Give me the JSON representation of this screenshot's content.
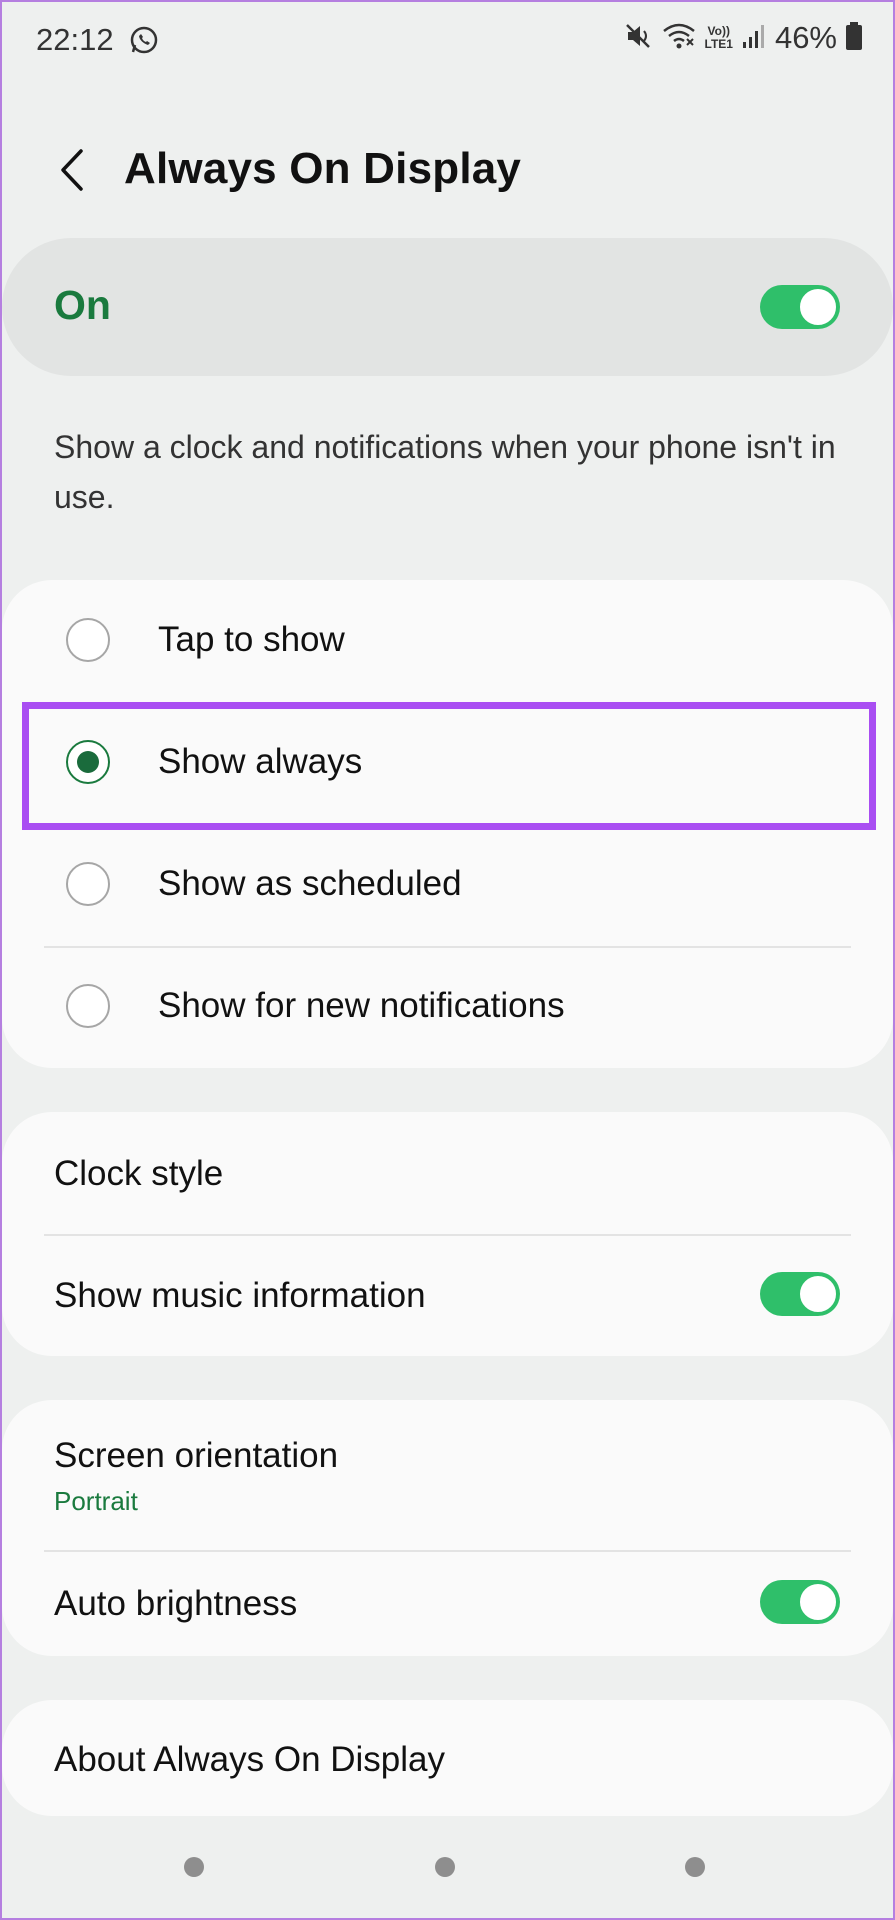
{
  "status_bar": {
    "time": "22:12",
    "battery_percent": "46%",
    "icons": [
      "whatsapp-icon",
      "mute-icon",
      "wifi-icon",
      "volte-lte-icon",
      "signal-icon",
      "battery-icon"
    ],
    "volte_label_top": "Vo))",
    "volte_label_bottom": "LTE1"
  },
  "header": {
    "title": "Always On Display",
    "back_icon": "chevron-left-icon"
  },
  "master": {
    "label": "On",
    "enabled": true
  },
  "description": "Show a clock and notifications when your phone isn't in use.",
  "display_mode": {
    "options": [
      {
        "label": "Tap to show",
        "selected": false
      },
      {
        "label": "Show always",
        "selected": true
      },
      {
        "label": "Show as scheduled",
        "selected": false
      },
      {
        "label": "Show for new notifications",
        "selected": false
      }
    ]
  },
  "clock_card": {
    "clock_style": "Clock style",
    "music_info": "Show music information",
    "music_info_enabled": true
  },
  "orientation_card": {
    "orientation_label": "Screen orientation",
    "orientation_value": "Portrait",
    "auto_brightness": "Auto brightness",
    "auto_brightness_enabled": true
  },
  "about": {
    "label": "About Always On Display"
  },
  "colors": {
    "accent_green": "#1a7a3e",
    "toggle_green": "#2fbf6a",
    "highlight_purple": "#a94ef2",
    "background": "#eef0ef"
  }
}
